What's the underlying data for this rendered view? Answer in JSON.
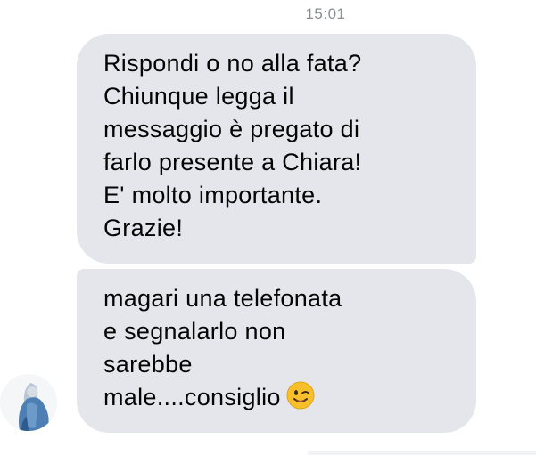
{
  "conversation": {
    "timestamp": "15:01",
    "messages": [
      {
        "lines": [
          "Rispondi o no alla fata?",
          "Chiunque legga il",
          "messaggio è pregato di",
          "farlo presente a Chiara!",
          "E' molto importante.",
          "Grazie!"
        ]
      },
      {
        "lines": [
          "magari una telefonata",
          "e segnalarlo non",
          "sarebbe",
          "male....consiglio"
        ],
        "emoji": "winking-face-emoji"
      }
    ]
  },
  "colors": {
    "bubble_background": "#e4e6eb",
    "text": "#050505",
    "timestamp": "#8a8d91",
    "emoji_yellow": "#f7c02b"
  },
  "icons": {
    "avatar": "user-avatar-photo",
    "emoji": "winking-face-emoji"
  }
}
